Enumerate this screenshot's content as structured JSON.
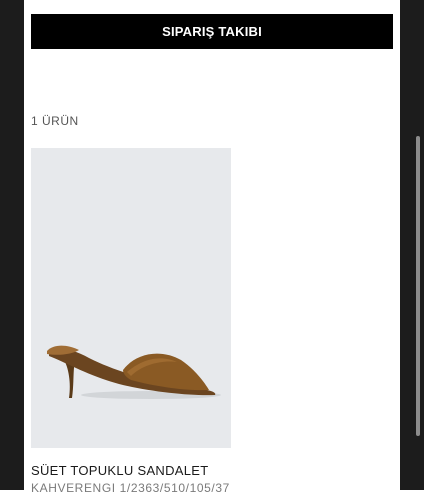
{
  "order": {
    "tracking_button_label": "SIPARIŞ TAKIBI",
    "item_count": "1 ÜRÜN"
  },
  "product": {
    "name": "SÜET TOPUKLU SANDALET",
    "details": "KAHVERENGI 1/2363/510/105/37",
    "image_icon": "heeled-sandal-photo"
  },
  "colors": {
    "button_bg": "#000000",
    "image_bg": "#e7e9ec",
    "suede_brown": "#8a5a24"
  }
}
